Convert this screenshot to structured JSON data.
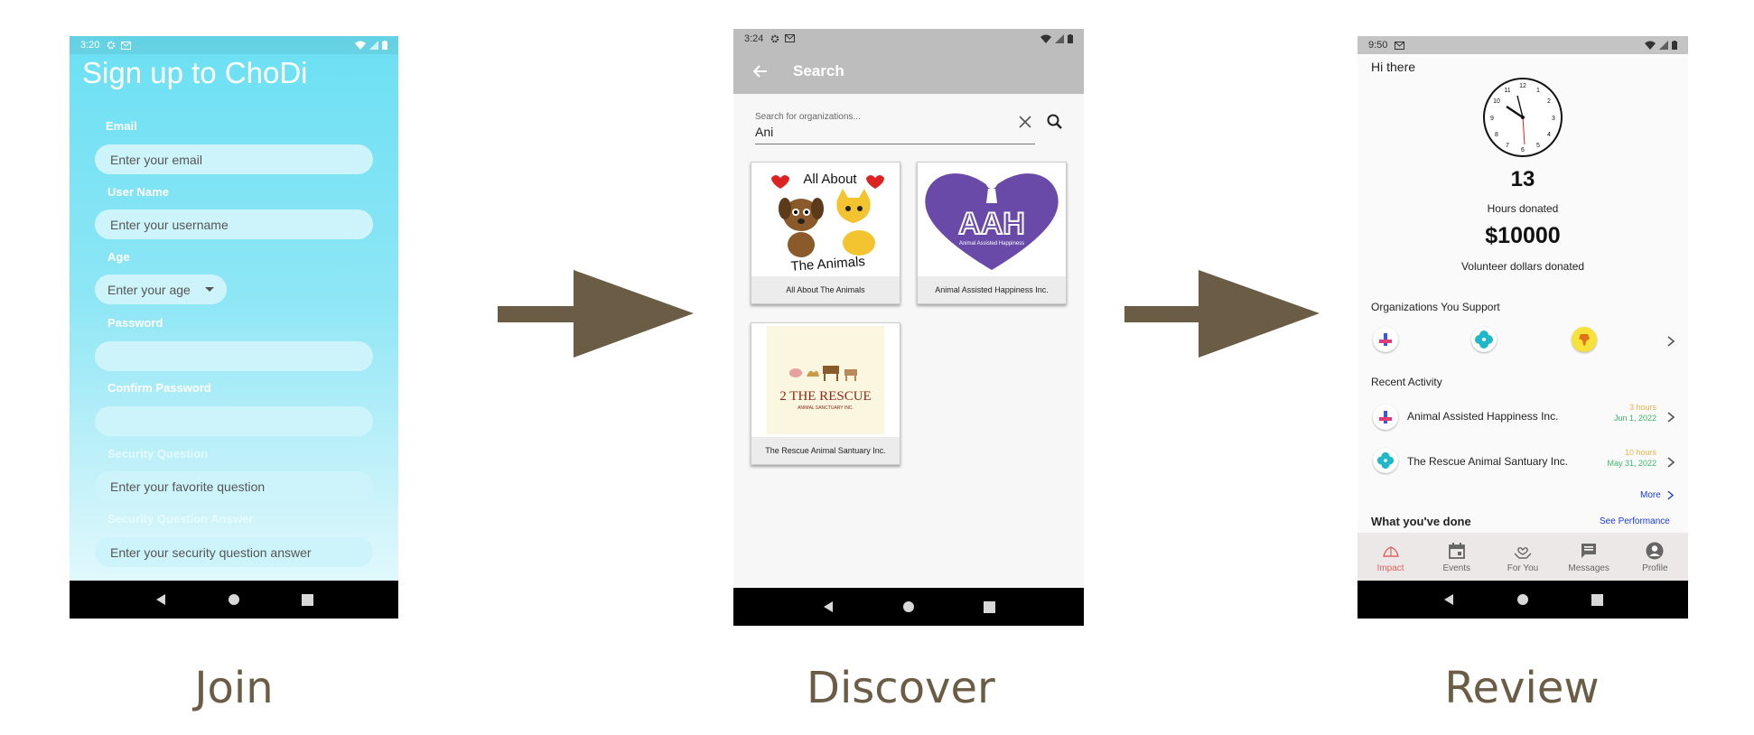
{
  "join": {
    "status_time": "3:20",
    "title": "Sign up to ChoDi",
    "email_label": "Email",
    "email_placeholder": "Enter your email",
    "username_label": "User Name",
    "username_placeholder": "Enter your username",
    "age_label": "Age",
    "age_placeholder": "Enter your age",
    "password_label": "Password",
    "confirm_label": "Confirm Password",
    "secq_label": "Security Question",
    "secq_placeholder": "Enter your favorite question",
    "seca_label": "Security Question Answer",
    "seca_placeholder": "Enter your security question answer",
    "caption": "Join"
  },
  "discover": {
    "status_time": "3:24",
    "title": "Search",
    "search_label": "Search for organizations...",
    "search_value": "Ani",
    "orgs": [
      {
        "name": "All About The Animals",
        "logo_top": "All About",
        "logo_bottom": "The Animals"
      },
      {
        "name": "Animal Assisted Happiness Inc.",
        "logo_text": "AAH",
        "logo_sub": "Animal Assisted Happiness"
      },
      {
        "name": "The Rescue Animal Santuary Inc.",
        "logo_text": "2 THE RESCUE",
        "logo_sub": "ANIMAL SANCTUARY INC."
      }
    ],
    "caption": "Discover"
  },
  "review": {
    "status_time": "9:50",
    "greeting": "Hi there",
    "hours_value": "13",
    "hours_label": "Hours donated",
    "dollars_value": "$10000",
    "dollars_label": "Volunteer dollars donated",
    "orgs_title": "Organizations You Support",
    "recent_title": "Recent Activity",
    "activities": [
      {
        "name": "Animal Assisted Happiness Inc.",
        "time": "3 hours",
        "date": "Jun 1, 2022"
      },
      {
        "name": "The Rescue Animal Santuary Inc.",
        "time": "10 hours",
        "date": "May 31, 2022"
      }
    ],
    "more_label": "More",
    "done_title": "What you've done",
    "see_perf_label": "See Performance",
    "tabs": [
      {
        "label": "Impact",
        "icon": "impact-icon"
      },
      {
        "label": "Events",
        "icon": "calendar-icon"
      },
      {
        "label": "For You",
        "icon": "hands-heart-icon"
      },
      {
        "label": "Messages",
        "icon": "message-icon"
      },
      {
        "label": "Profile",
        "icon": "person-icon"
      }
    ],
    "caption": "Review"
  },
  "colors": {
    "arrow": "#6b5d45",
    "join_bg": "#6be0f3",
    "impact_active": "#e06262",
    "link": "#1a3ad8"
  }
}
